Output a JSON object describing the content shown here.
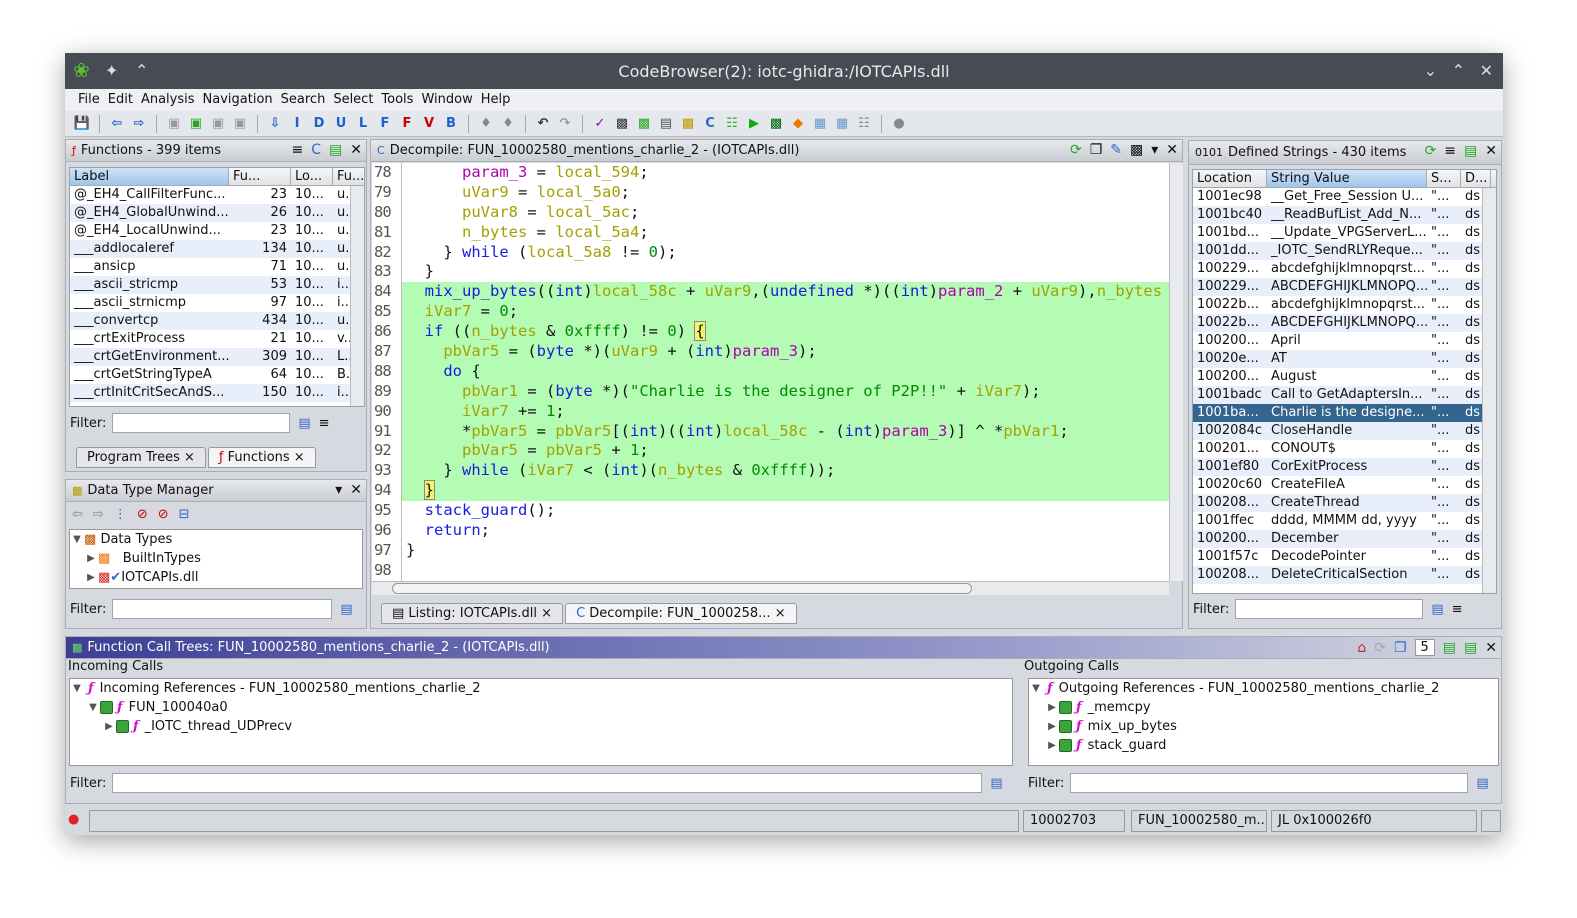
{
  "window": {
    "title": "CodeBrowser(2): iotc-ghidra:/IOTCAPIs.dll"
  },
  "menu": [
    "File",
    "Edit",
    "Analysis",
    "Navigation",
    "Search",
    "Select",
    "Tools",
    "Window",
    "Help"
  ],
  "toolbar": {
    "letters": [
      "I",
      "D",
      "U",
      "L",
      "F",
      "F",
      "V",
      "B"
    ]
  },
  "functions": {
    "title": "Functions - 399 items",
    "columns": [
      "Label",
      "Fu...",
      "Lo...",
      "Fu..."
    ],
    "rows": [
      [
        "@_EH4_CallFilterFunc...",
        "23",
        "10...",
        "u..."
      ],
      [
        "@_EH4_GlobalUnwind...",
        "26",
        "10...",
        "u..."
      ],
      [
        "@_EH4_LocalUnwind...",
        "23",
        "10...",
        "u..."
      ],
      [
        "___addlocaleref",
        "134",
        "10...",
        "u..."
      ],
      [
        "___ansicp",
        "71",
        "10...",
        "u..."
      ],
      [
        "___ascii_stricmp",
        "53",
        "10...",
        "i..."
      ],
      [
        "___ascii_strnicmp",
        "97",
        "10...",
        "i..."
      ],
      [
        "___convertcp",
        "434",
        "10...",
        "u..."
      ],
      [
        "___crtExitProcess",
        "21",
        "10...",
        "v..."
      ],
      [
        "___crtGetEnvironment...",
        "309",
        "10...",
        "L..."
      ],
      [
        "___crtGetStringTypeA",
        "64",
        "10...",
        "B..."
      ],
      [
        "___crtInitCritSecAndS...",
        "150",
        "10...",
        "i..."
      ]
    ],
    "filter_label": "Filter:",
    "tabs": [
      "Program Trees",
      "Functions"
    ]
  },
  "datatypes": {
    "title": "Data Type Manager",
    "tree": [
      "Data Types",
      "BuiltInTypes",
      "IOTCAPIs.dll"
    ],
    "filter_label": "Filter:"
  },
  "decompile": {
    "title": "Decompile: FUN_10002580_mentions_charlie_2 -  (IOTCAPIs.dll)",
    "lines": [
      {
        "n": "78",
        "t": [
          [
            "      ",
            ""
          ],
          [
            "param_3",
            "p"
          ],
          [
            " = ",
            ""
          ],
          [
            "local_594",
            "v"
          ],
          [
            ";",
            ""
          ]
        ]
      },
      {
        "n": "79",
        "t": [
          [
            "      ",
            ""
          ],
          [
            "uVar9",
            "v"
          ],
          [
            " = ",
            ""
          ],
          [
            "local_5a0",
            "v"
          ],
          [
            ";",
            ""
          ]
        ]
      },
      {
        "n": "80",
        "t": [
          [
            "      ",
            ""
          ],
          [
            "puVar8",
            "v"
          ],
          [
            " = ",
            ""
          ],
          [
            "local_5ac",
            "v"
          ],
          [
            ";",
            ""
          ]
        ]
      },
      {
        "n": "81",
        "t": [
          [
            "      ",
            ""
          ],
          [
            "n_bytes",
            "v"
          ],
          [
            " = ",
            ""
          ],
          [
            "local_5a4",
            "v"
          ],
          [
            ";",
            ""
          ]
        ]
      },
      {
        "n": "82",
        "t": [
          [
            "    } ",
            ""
          ],
          [
            "while",
            "k"
          ],
          [
            " (",
            ""
          ],
          [
            "local_5a8",
            "v"
          ],
          [
            " != ",
            ""
          ],
          [
            "0",
            "n"
          ],
          [
            ");",
            ""
          ]
        ]
      },
      {
        "n": "83",
        "t": [
          [
            "  }",
            ""
          ]
        ]
      },
      {
        "n": "84",
        "hl": true,
        "t": [
          [
            "  ",
            ""
          ],
          [
            "mix_up_bytes",
            "f"
          ],
          [
            "((",
            ""
          ],
          [
            "int",
            "k"
          ],
          [
            ")",
            ""
          ],
          [
            "local_58c",
            "v"
          ],
          [
            " + ",
            ""
          ],
          [
            "uVar9",
            "v"
          ],
          [
            ",(",
            ""
          ],
          [
            "undefined",
            "k"
          ],
          [
            " *)((",
            ""
          ],
          [
            "int",
            "k"
          ],
          [
            ")",
            ""
          ],
          [
            "param_2",
            "p"
          ],
          [
            " + ",
            ""
          ],
          [
            "uVar9",
            "v"
          ],
          [
            "),",
            ""
          ],
          [
            "n_bytes",
            "v"
          ]
        ]
      },
      {
        "n": "85",
        "hl": true,
        "t": [
          [
            "  ",
            ""
          ],
          [
            "iVar7",
            "v"
          ],
          [
            " = ",
            ""
          ],
          [
            "0",
            "n"
          ],
          [
            ";",
            ""
          ]
        ]
      },
      {
        "n": "86",
        "hl": true,
        "t": [
          [
            "  ",
            ""
          ],
          [
            "if",
            "k"
          ],
          [
            " ((",
            ""
          ],
          [
            "n_bytes",
            "v"
          ],
          [
            " & ",
            ""
          ],
          [
            "0xffff",
            "n"
          ],
          [
            ") != ",
            ""
          ],
          [
            "0",
            "n"
          ],
          [
            ") ",
            ""
          ],
          [
            "{",
            "b"
          ]
        ]
      },
      {
        "n": "87",
        "hl": true,
        "t": [
          [
            "    ",
            ""
          ],
          [
            "pbVar5",
            "v"
          ],
          [
            " = (",
            ""
          ],
          [
            "byte",
            "k"
          ],
          [
            " *)(",
            ""
          ],
          [
            "uVar9",
            "v"
          ],
          [
            " + (",
            ""
          ],
          [
            "int",
            "k"
          ],
          [
            ")",
            ""
          ],
          [
            "param_3",
            "p"
          ],
          [
            ");",
            ""
          ]
        ]
      },
      {
        "n": "88",
        "hl": true,
        "t": [
          [
            "    ",
            ""
          ],
          [
            "do",
            "k"
          ],
          [
            " {",
            ""
          ]
        ]
      },
      {
        "n": "89",
        "hl": true,
        "t": [
          [
            "      ",
            ""
          ],
          [
            "pbVar1",
            "v"
          ],
          [
            " = (",
            ""
          ],
          [
            "byte",
            "k"
          ],
          [
            " *)(",
            ""
          ],
          [
            "\"Charlie is the designer of P2P!!\"",
            "s"
          ],
          [
            " + ",
            ""
          ],
          [
            "iVar7",
            "v"
          ],
          [
            ");",
            ""
          ]
        ]
      },
      {
        "n": "90",
        "hl": true,
        "t": [
          [
            "      ",
            ""
          ],
          [
            "iVar7",
            "v"
          ],
          [
            " += ",
            ""
          ],
          [
            "1",
            "n"
          ],
          [
            ";",
            ""
          ]
        ]
      },
      {
        "n": "91",
        "hl": true,
        "t": [
          [
            "      *",
            ""
          ],
          [
            "pbVar5",
            "v"
          ],
          [
            " = ",
            ""
          ],
          [
            "pbVar5",
            "v"
          ],
          [
            "[(",
            ""
          ],
          [
            "int",
            "k"
          ],
          [
            ")((",
            ""
          ],
          [
            "int",
            "k"
          ],
          [
            ")",
            ""
          ],
          [
            "local_58c",
            "v"
          ],
          [
            " - (",
            ""
          ],
          [
            "int",
            "k"
          ],
          [
            ")",
            ""
          ],
          [
            "param_3",
            "p"
          ],
          [
            ")] ^ *",
            ""
          ],
          [
            "pbVar1",
            "v"
          ],
          [
            ";",
            ""
          ]
        ]
      },
      {
        "n": "92",
        "hl": true,
        "t": [
          [
            "      ",
            ""
          ],
          [
            "pbVar5",
            "v"
          ],
          [
            " = ",
            ""
          ],
          [
            "pbVar5",
            "v"
          ],
          [
            " + ",
            ""
          ],
          [
            "1",
            "n"
          ],
          [
            ";",
            ""
          ]
        ]
      },
      {
        "n": "93",
        "hl": true,
        "t": [
          [
            "    } ",
            ""
          ],
          [
            "while",
            "k"
          ],
          [
            " (",
            ""
          ],
          [
            "iVar7",
            "v"
          ],
          [
            " < (",
            ""
          ],
          [
            "int",
            "k"
          ],
          [
            ")(",
            ""
          ],
          [
            "n_bytes",
            "v"
          ],
          [
            " & ",
            ""
          ],
          [
            "0xffff",
            "n"
          ],
          [
            "));",
            ""
          ]
        ]
      },
      {
        "n": "94",
        "hl": true,
        "t": [
          [
            "  ",
            ""
          ],
          [
            "}",
            "b"
          ]
        ]
      },
      {
        "n": "95",
        "t": [
          [
            "  ",
            ""
          ],
          [
            "stack_guard",
            "f"
          ],
          [
            "();",
            ""
          ]
        ]
      },
      {
        "n": "96",
        "t": [
          [
            "  ",
            ""
          ],
          [
            "return",
            "k"
          ],
          [
            ";",
            ""
          ]
        ]
      },
      {
        "n": "97",
        "t": [
          [
            "}",
            ""
          ]
        ]
      },
      {
        "n": "98",
        "t": [
          [
            "",
            ""
          ]
        ]
      }
    ],
    "tabs": [
      "Listing:  IOTCAPIs.dll",
      "Decompile: FUN_1000258..."
    ]
  },
  "strings": {
    "title": "Defined Strings - 430 items",
    "columns": [
      "Location",
      "String Value",
      "S...",
      "D..."
    ],
    "rows": [
      [
        "1001ec98",
        "__Get_Free_Session U...",
        "\"...",
        "ds"
      ],
      [
        "1001bc40",
        "__ReadBufList_Add_N...",
        "\"...",
        "ds"
      ],
      [
        "1001bd...",
        "__Update_VPGServerL...",
        "\"...",
        "ds"
      ],
      [
        "1001dd...",
        "_IOTC_SendRLYReque...",
        "\"...",
        "ds"
      ],
      [
        "100229...",
        "abcdefghijklmnopqrst...",
        "\"...",
        "ds"
      ],
      [
        "100229...",
        "ABCDEFGHIJKLMNOPQ...",
        "\"...",
        "ds"
      ],
      [
        "10022b...",
        "abcdefghijklmnopqrst...",
        "\"...",
        "ds"
      ],
      [
        "10022b...",
        "ABCDEFGHIJKLMNOPQ...",
        "\"...",
        "ds"
      ],
      [
        "100200...",
        "April",
        "\"...",
        "ds"
      ],
      [
        "10020e...",
        "AT",
        "\"...",
        "ds"
      ],
      [
        "100200...",
        "August",
        "\"...",
        "ds"
      ],
      [
        "1001badc",
        "Call to GetAdaptersIn...",
        "\"...",
        "ds"
      ],
      [
        "1001ba...",
        "Charlie is the designe...",
        "\"...",
        "ds"
      ],
      [
        "1002084c",
        "CloseHandle",
        "\"...",
        "ds"
      ],
      [
        "100201...",
        "CONOUT$",
        "\"...",
        "ds"
      ],
      [
        "1001ef80",
        "CorExitProcess",
        "\"...",
        "ds"
      ],
      [
        "10020c60",
        "CreateFileA",
        "\"...",
        "ds"
      ],
      [
        "100208...",
        "CreateThread",
        "\"...",
        "ds"
      ],
      [
        "1001ffec",
        "dddd, MMMM dd, yyyy",
        "\"...",
        "ds"
      ],
      [
        "100200...",
        "December",
        "\"...",
        "ds"
      ],
      [
        "1001f57c",
        "DecodePointer",
        "\"...",
        "ds"
      ],
      [
        "100208...",
        "DeleteCriticalSection",
        "\"...",
        "ds"
      ]
    ],
    "selected_index": 12,
    "filter_label": "Filter:"
  },
  "calltrees": {
    "title": "Function Call Trees: FUN_10002580_mentions_charlie_2 -  (IOTCAPIs.dll)",
    "depth": "5",
    "incoming": {
      "label": "Incoming Calls",
      "root": "Incoming References - FUN_10002580_mentions_charlie_2",
      "items": [
        "FUN_100040a0",
        "_IOTC_thread_UDPrecv"
      ]
    },
    "outgoing": {
      "label": "Outgoing Calls",
      "root": "Outgoing References - FUN_10002580_mentions_charlie_2",
      "items": [
        "_memcpy",
        "mix_up_bytes",
        "stack_guard"
      ]
    },
    "filter_label": "Filter:"
  },
  "status": {
    "address": "10002703",
    "function": "FUN_10002580_m...",
    "instruction": "JL 0x100026f0"
  }
}
